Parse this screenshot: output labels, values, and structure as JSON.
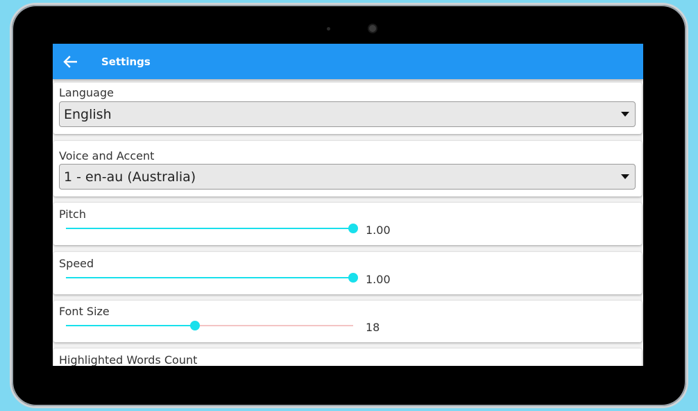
{
  "app": {
    "title": "Settings"
  },
  "accent_color": "#2196f3",
  "slider_color": "#18e0ec",
  "settings": {
    "language": {
      "label": "Language",
      "value": "English"
    },
    "voice": {
      "label": "Voice and Accent",
      "value": "1 - en-au (Australia)"
    },
    "pitch": {
      "label": "Pitch",
      "value": "1.00",
      "fraction": 1.0
    },
    "speed": {
      "label": "Speed",
      "value": "1.00",
      "fraction": 1.0
    },
    "font_size": {
      "label": "Font Size",
      "value": "18",
      "fraction": 0.45
    },
    "highlighted_words": {
      "label": "Highlighted Words Count"
    }
  }
}
